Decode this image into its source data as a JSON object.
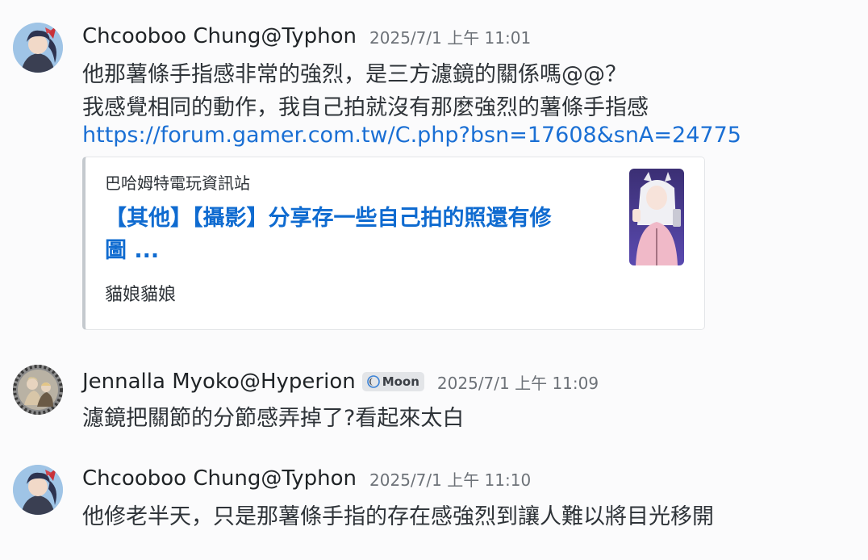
{
  "messages": [
    {
      "username": "Chcooboo Chung@Typhon",
      "timestamp": "2025/7/1 上午 11:01",
      "lines": [
        "他那薯條手指感非常的強烈，是三方濾鏡的關係嗎@@？",
        "我感覺相同的動作，我自己拍就沒有那麼強烈的薯條手指感"
      ],
      "link": "https://forum.gamer.com.tw/C.php?bsn=17608&snA=24775",
      "embed": {
        "provider": "巴哈姆特電玩資訊站",
        "title_line1": "【其他】【攝影】分享存一些自己拍的照還有修",
        "title_line2": "圖 ...",
        "description": "貓娘貓娘",
        "thumbnail_icon": "catgirl-photo-thumbnail"
      },
      "avatar_icon": "chcooboo-avatar"
    },
    {
      "username": "Jennalla Myoko@Hyperion",
      "badge": "Moon",
      "badge_icon": "moon-icon",
      "timestamp": "2025/7/1 上午 11:09",
      "lines": [
        "濾鏡把關節的分節感弄掉了?看起來太白"
      ],
      "avatar_icon": "jennalla-avatar"
    },
    {
      "username": "Chcooboo Chung@Typhon",
      "timestamp": "2025/7/1 上午 11:10",
      "lines": [
        "他修老半天，只是那薯條手指的存在感強烈到讓人難以將目光移開"
      ],
      "avatar_icon": "chcooboo-avatar"
    }
  ],
  "colors": {
    "background": "#fbfbfc",
    "link": "#1a6fd4",
    "embed_title": "#0f6bd0",
    "timestamp": "#6d7278"
  }
}
